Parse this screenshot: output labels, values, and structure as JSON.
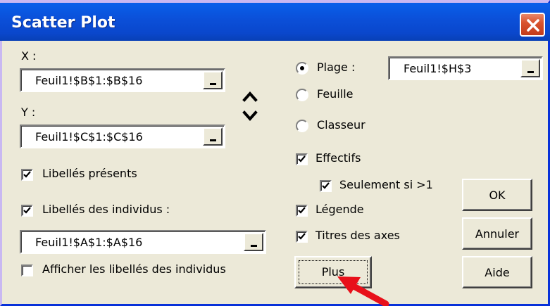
{
  "window": {
    "title": "Scatter Plot",
    "close_icon": "close-icon"
  },
  "left": {
    "x_label": "X :",
    "x_value": "Feuil1!$B$1:$B$16",
    "y_label": "Y :",
    "y_value": "Feuil1!$C$1:$C$16",
    "swap_icon": "up-down-swap-icon",
    "libelles_presents": {
      "label": "Libellés présents",
      "checked": true
    },
    "libelles_individus": {
      "label": "Libellés des individus :",
      "checked": true
    },
    "individus_value": "Feuil1!$A$1:$A$16",
    "afficher_libelles": {
      "label": "Afficher les libellés des individus",
      "checked": false
    }
  },
  "right": {
    "output_options": [
      {
        "label": "Plage :",
        "selected": true
      },
      {
        "label": "Feuille",
        "selected": false
      },
      {
        "label": "Classeur",
        "selected": false
      }
    ],
    "plage_value": "Feuil1!$H$3",
    "effectifs": {
      "label": "Effectifs",
      "checked": true
    },
    "seulement": {
      "label": "Seulement si >1",
      "checked": true
    },
    "legende": {
      "label": "Légende",
      "checked": true
    },
    "titres_axes": {
      "label": "Titres des axes",
      "checked": true
    }
  },
  "buttons": {
    "ok": "OK",
    "annuler": "Annuler",
    "aide": "Aide",
    "plus": "Plus"
  },
  "accent_colors": {
    "titlebar": "#0A52DE",
    "close": "#D9542F",
    "arrow": "#E8101A"
  }
}
